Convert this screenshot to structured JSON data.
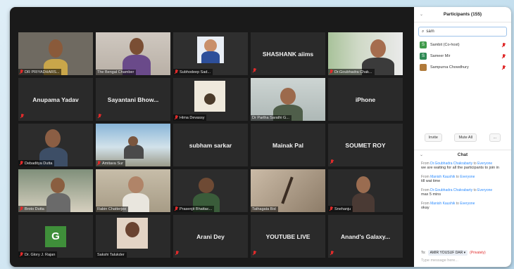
{
  "participants_panel": {
    "title": "Participants (155)",
    "search_value": "sam",
    "items": [
      {
        "name": "Sambit (Co-host)",
        "initial": "S",
        "color": "#3f9a4a"
      },
      {
        "name": "Sameer Mir",
        "initial": "S",
        "color": "#2f8a55"
      },
      {
        "name": "Sampurna Chowdhury",
        "initial": "",
        "color": "#b07a3a"
      }
    ],
    "invite_label": "Invite",
    "mute_all_label": "Mute All",
    "more_label": "..."
  },
  "chat": {
    "title": "Chat",
    "messages": [
      {
        "from": "Dr.Goubhadra Chakrabarty",
        "to_prefix": "to",
        "to": "Everyone",
        "text": "we are waiting for all the participants to join in"
      },
      {
        "from": "Manish Kaushik",
        "to_prefix": "to",
        "to": "Everyone",
        "text": "till wat time"
      },
      {
        "from": "Dr.Goubhadra Chakrabarty",
        "to_prefix": "to",
        "to": "Everyone",
        "text": "max 5 mins"
      },
      {
        "from": "Manish Kaushik",
        "to_prefix": "to",
        "to": "Everyone",
        "text": "okay"
      }
    ],
    "to_label": "To:",
    "recipient": "AMIR YOUSUF DAR ▾",
    "privately": "(Privately)",
    "input_placeholder": "Type message here..."
  },
  "tiles": [
    {
      "type": "video",
      "label": "DR PRIYADHARS..."
    },
    {
      "type": "video",
      "label": "The Bengal Chamber"
    },
    {
      "type": "video",
      "label": "Subhodeep Sad..."
    },
    {
      "type": "name",
      "name": "SHASHANK aiims"
    },
    {
      "type": "video",
      "label": "Dr.Goubhadra Chak..."
    },
    {
      "type": "name",
      "name": "Anupama Yadav"
    },
    {
      "type": "name",
      "name": "Sayantani Bhow..."
    },
    {
      "type": "video",
      "label": "Hima Devassy"
    },
    {
      "type": "video",
      "label": "Dr Partha Sarathi G..."
    },
    {
      "type": "name",
      "name": "iPhone"
    },
    {
      "type": "video",
      "label": "Debaditya Dutta"
    },
    {
      "type": "video",
      "label": "Amitava Sur"
    },
    {
      "type": "name",
      "name": "subham sarkar"
    },
    {
      "type": "name",
      "name": "Mainak Pal"
    },
    {
      "type": "name",
      "name": "SOUMET ROY"
    },
    {
      "type": "video",
      "label": "Broto Dutta"
    },
    {
      "type": "video",
      "label": "Rabin Chatterjee"
    },
    {
      "type": "video",
      "label": "Prasenjit Bhattac..."
    },
    {
      "type": "video",
      "label": "Tathagata Bid"
    },
    {
      "type": "video",
      "label": "Snehanju"
    },
    {
      "type": "avatar",
      "label": "Dr. Glory J. Rajan",
      "initial": "G"
    },
    {
      "type": "video",
      "label": "Sakshi Talukder"
    },
    {
      "type": "name",
      "name": "Arani Dey"
    },
    {
      "type": "name",
      "name": "YOUTUBE LIVE"
    },
    {
      "type": "name",
      "name": "Anand's Galaxy..."
    }
  ],
  "colors": {
    "accent": "#2d8cff",
    "muted_red": "#e02b2b",
    "active_speaker": "#c8d94a"
  }
}
